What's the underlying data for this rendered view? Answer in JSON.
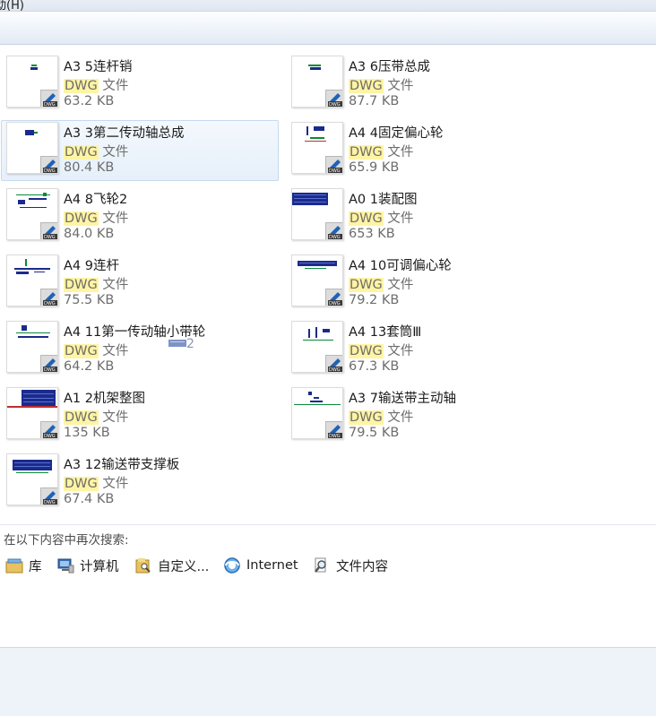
{
  "window": {
    "top_fragment": "动(H)"
  },
  "results": [
    {
      "name": "A3 5连杆销",
      "type_highlight": "DWG",
      "type_suffix": " 文件",
      "size": "63.2 KB",
      "selected": false
    },
    {
      "name": "A3 6压带总成",
      "type_highlight": "DWG",
      "type_suffix": " 文件",
      "size": "87.7 KB",
      "selected": false
    },
    {
      "name": "A3 3第二传动轴总成",
      "type_highlight": "DWG",
      "type_suffix": " 文件",
      "size": "80.4 KB",
      "selected": true
    },
    {
      "name": "A4 4固定偏心轮",
      "type_highlight": "DWG",
      "type_suffix": " 文件",
      "size": "65.9 KB",
      "selected": false
    },
    {
      "name": "A4 8飞轮2",
      "type_highlight": "DWG",
      "type_suffix": " 文件",
      "size": "84.0 KB",
      "selected": false
    },
    {
      "name": "A0 1装配图",
      "type_highlight": "DWG",
      "type_suffix": " 文件",
      "size": "653 KB",
      "selected": false
    },
    {
      "name": "A4 9连杆",
      "type_highlight": "DWG",
      "type_suffix": " 文件",
      "size": "75.5 KB",
      "selected": false
    },
    {
      "name": "A4 10可调偏心轮",
      "type_highlight": "DWG",
      "type_suffix": " 文件",
      "size": "79.2 KB",
      "selected": false
    },
    {
      "name": "A4 11第一传动轴小带轮",
      "type_highlight": "DWG",
      "type_suffix": " 文件",
      "size": "64.2 KB",
      "selected": false
    },
    {
      "name": "A4 13套筒Ⅲ",
      "type_highlight": "DWG",
      "type_suffix": " 文件",
      "size": "67.3 KB",
      "selected": false
    },
    {
      "name": "A1 2机架整图",
      "type_highlight": "DWG",
      "type_suffix": " 文件",
      "size": "135 KB",
      "selected": false
    },
    {
      "name": "A3 7输送带主动轴",
      "type_highlight": "DWG",
      "type_suffix": " 文件",
      "size": "79.5 KB",
      "selected": false
    },
    {
      "name": "A3 12输送带支撑板",
      "type_highlight": "DWG",
      "type_suffix": " 文件",
      "size": "67.4 KB",
      "selected": false
    }
  ],
  "artifact_text": "2",
  "search_again": {
    "title": "在以下内容中再次搜索:",
    "options": [
      {
        "label": "库",
        "icon": "library-icon"
      },
      {
        "label": "计算机",
        "icon": "computer-icon"
      },
      {
        "label": "自定义...",
        "icon": "folder-search-icon"
      },
      {
        "label": "Internet",
        "icon": "internet-icon"
      },
      {
        "label": "文件内容",
        "icon": "file-contents-search-icon"
      }
    ]
  },
  "colors": {
    "highlight": "#fff4a3",
    "selection": "#e6f0fa",
    "selection_border": "#c6d9ef"
  }
}
